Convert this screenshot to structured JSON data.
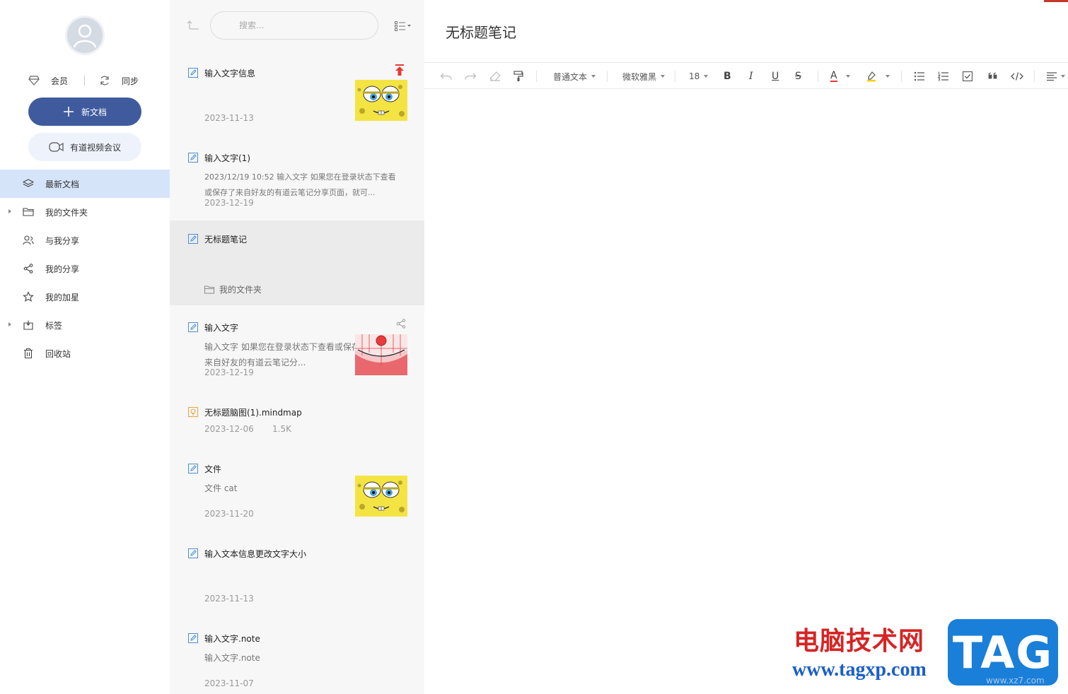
{
  "sidebar": {
    "member_label": "会员",
    "sync_label": "同步",
    "new_doc_label": "新文档",
    "meeting_label": "有道视频会议",
    "nav": [
      {
        "label": "最新文档",
        "icon": "layers-icon",
        "active": true
      },
      {
        "label": "我的文件夹",
        "icon": "folder-icon",
        "expandable": true
      },
      {
        "label": "与我分享",
        "icon": "users-icon"
      },
      {
        "label": "我的分享",
        "icon": "share-icon"
      },
      {
        "label": "我的加星",
        "icon": "star-icon"
      },
      {
        "label": "标签",
        "icon": "tag-icon",
        "expandable": true
      },
      {
        "label": "回收站",
        "icon": "trash-icon"
      }
    ]
  },
  "list": {
    "search_placeholder": "搜索...",
    "docs": [
      {
        "title": "输入文字信息",
        "snippet": "",
        "date": "2023-11-13",
        "thumb": "spongebob",
        "pinned": true
      },
      {
        "title": "输入文字(1)",
        "snippet": "2023/12/19 10:52 输入文字 如果您在登录状态下查看或保存了来自好友的有道云笔记分享页面，就可...",
        "date": "2023-12-19"
      },
      {
        "title": "无标题笔记",
        "snippet": "",
        "folder": "我的文件夹",
        "selected": true
      },
      {
        "title": "输入文字",
        "snippet": "输入文字 如果您在登录状态下查看或保存了来自好友的有道云笔记分...",
        "date": "2023-12-19",
        "thumb": "patrick",
        "shared": true
      },
      {
        "title": "无标题脑图(1).mindmap",
        "snippet": "",
        "date": "2023-12-06",
        "size": "1.5K",
        "type": "mindmap"
      },
      {
        "title": "文件",
        "snippet": "文件 cat",
        "date": "2023-11-20",
        "thumb": "spongebob"
      },
      {
        "title": "输入文本信息更改文字大小",
        "snippet": "",
        "date": "2023-11-13"
      },
      {
        "title": "输入文字.note",
        "snippet": "输入文字.note",
        "date": "2023-11-07"
      }
    ]
  },
  "editor": {
    "title": "无标题笔记",
    "toolbar": {
      "paragraph_style": "普通文本",
      "font_family": "微软雅黑",
      "font_size": "18",
      "bold": "B",
      "italic": "I",
      "underline": "U",
      "strike": "S",
      "font_color": "A"
    }
  },
  "watermark": {
    "site_name": "电脑技术网",
    "url": "www.tagxp.com",
    "tag": "TAG",
    "sub_url": "www.xz7.com"
  },
  "colors": {
    "primary": "#3f5b9e",
    "active_nav": "#d6e4fa",
    "doc_icon": "#4a90d9",
    "mindmap_icon": "#f0a040",
    "pin": "#e53935"
  }
}
